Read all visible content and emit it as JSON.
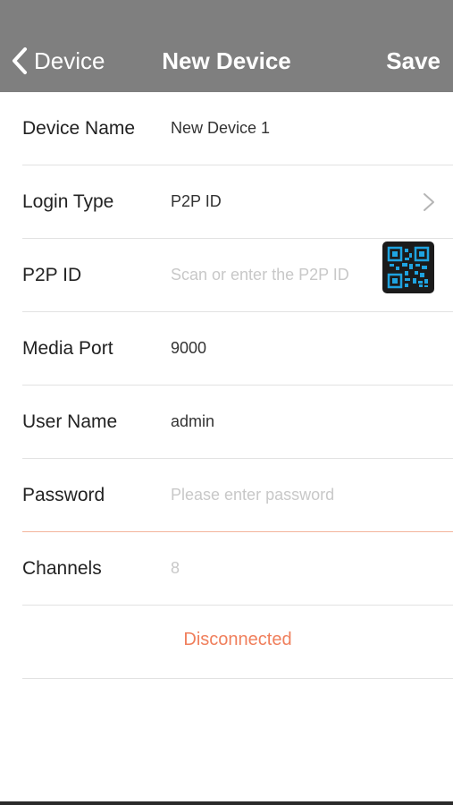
{
  "nav": {
    "back_label": "Device",
    "title": "New Device",
    "save_label": "Save"
  },
  "form": {
    "device_name": {
      "label": "Device Name",
      "value": "New Device 1"
    },
    "login_type": {
      "label": "Login Type",
      "value": "P2P ID"
    },
    "p2p_id": {
      "label": "P2P ID",
      "placeholder": "Scan or enter the P2P ID"
    },
    "media_port": {
      "label": "Media Port",
      "value": "9000"
    },
    "user_name": {
      "label": "User Name",
      "value": "admin"
    },
    "password": {
      "label": "Password",
      "placeholder": "Please enter password"
    },
    "channels": {
      "label": "Channels",
      "value": "8"
    }
  },
  "status": {
    "text": "Disconnected",
    "color": "#f07f5c"
  },
  "colors": {
    "navbar": "#7f7f7f",
    "accent": "#f07f5c",
    "qr_icon": "#1fa3e0"
  },
  "icons": {
    "back": "chevron-left-icon",
    "login_type": "chevron-right-icon",
    "scan": "qr-code-icon"
  }
}
